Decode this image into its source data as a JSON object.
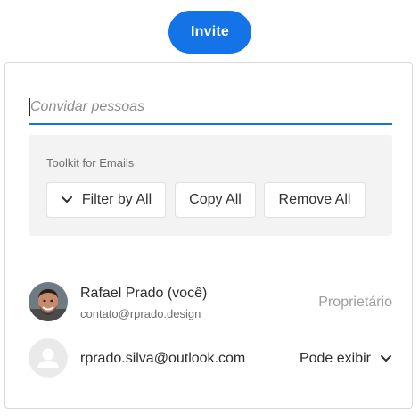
{
  "invite_button": {
    "label": "Invite"
  },
  "invite_input": {
    "placeholder": "Convidar pessoas",
    "value": ""
  },
  "toolkit": {
    "title": "Toolkit for Emails",
    "filter_label": "Filter by All",
    "copy_label": "Copy All",
    "remove_label": "Remove All"
  },
  "people": [
    {
      "name": "Rafael Prado (você)",
      "email": "contato@rprado.design",
      "role": "Proprietário",
      "avatar": "user-photo"
    },
    {
      "email": "rprado.silva@outlook.com",
      "role": "Pode exibir",
      "avatar": "user-placeholder-icon"
    }
  ],
  "colors": {
    "accent": "#1473e6",
    "panel_bg": "#f3f3f3",
    "muted_text": "#9e9e9e"
  }
}
